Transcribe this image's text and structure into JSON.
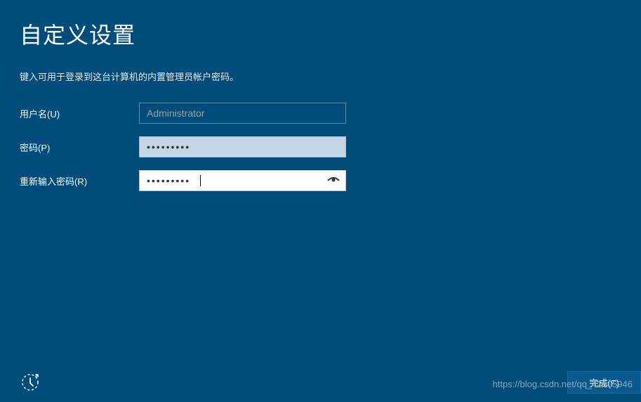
{
  "title": "自定义设置",
  "subtitle": "键入可用于登录到这台计算机的内置管理员帐户密码。",
  "form": {
    "username_label": "用户名(U)",
    "username_value": "Administrator",
    "password_label": "密码(P)",
    "password_value": "•••••••••",
    "confirm_label": "重新输入密码(R)",
    "confirm_value": "•••••••••"
  },
  "buttons": {
    "finish_label": "完成(F)"
  },
  "watermark": "https://blog.csdn.net/qq_42905946"
}
